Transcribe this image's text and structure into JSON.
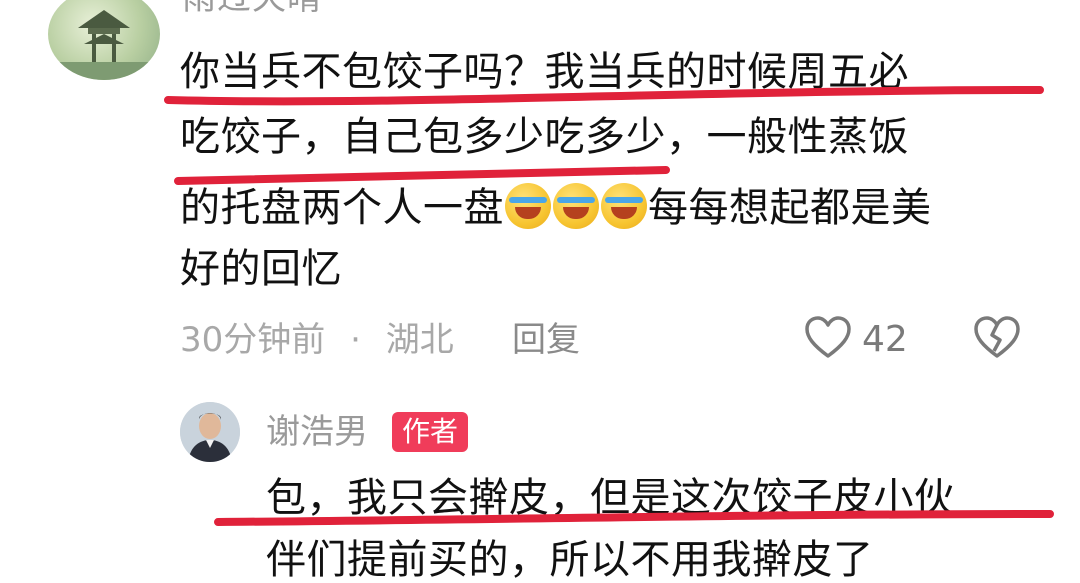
{
  "comment1": {
    "username": "雨过天晴",
    "lines": [
      "你当兵不包饺子吗？我当兵的时候周五必",
      "吃饺子，自己包多少吃多少，一般性蒸饭",
      "的托盘两个人一盘",
      "每每想起都是美",
      "好的回忆"
    ],
    "emojis": [
      "laughing-crying-emoji",
      "laughing-crying-emoji",
      "laughing-crying-emoji"
    ],
    "time": "30分钟前",
    "separator": "·",
    "location": "湖北",
    "reply_label": "回复",
    "like_count": "42"
  },
  "comment2": {
    "username": "谢浩男",
    "badge": "作者",
    "lines": [
      "包，我只会擀皮，但是这次饺子皮小伙",
      "伴们提前买的，所以不用我擀皮了"
    ]
  },
  "colors": {
    "underline": "#e0223a",
    "badge": "#f03c5a",
    "meta_text": "#a8a8a8"
  }
}
